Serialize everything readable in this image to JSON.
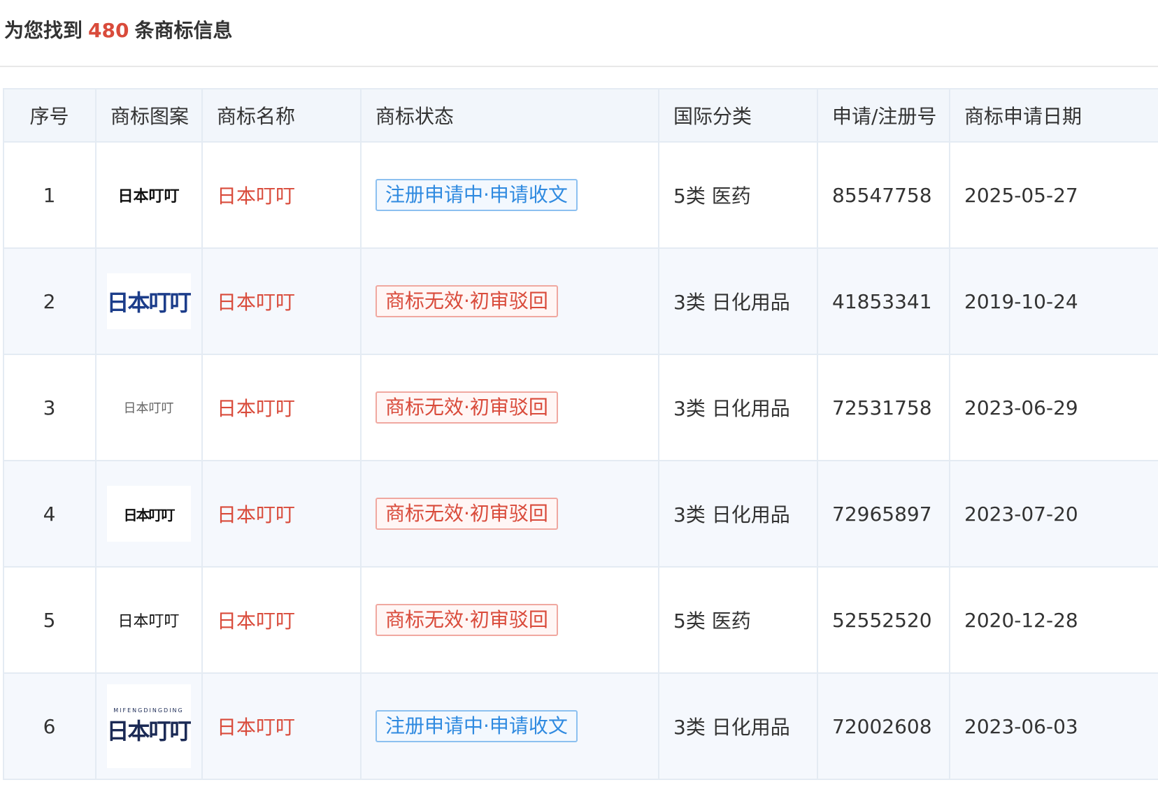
{
  "summary": {
    "prefix": "为您找到",
    "count": "480",
    "suffix": "条商标信息"
  },
  "colors": {
    "accent_red": "#d94b3b",
    "status_blue": "#2f8ae0",
    "header_bg": "#f2f6fb",
    "stripe_bg": "#f5f8fd"
  },
  "table": {
    "headers": {
      "index": "序号",
      "image": "商标图案",
      "name": "商标名称",
      "status": "商标状态",
      "class": "国际分类",
      "reg_no": "申请/注册号",
      "date": "商标申请日期"
    },
    "rows": [
      {
        "index": "1",
        "image_text": "日本叮叮",
        "name": "日本叮叮",
        "status": "注册申请中·申请收文",
        "status_color": "blue",
        "class": "5类 医药",
        "reg_no": "85547758",
        "date": "2025-05-27"
      },
      {
        "index": "2",
        "image_text": "日本叮叮",
        "name": "日本叮叮",
        "status": "商标无效·初审驳回",
        "status_color": "red",
        "class": "3类 日化用品",
        "reg_no": "41853341",
        "date": "2019-10-24"
      },
      {
        "index": "3",
        "image_text": "日本叮叮",
        "name": "日本叮叮",
        "status": "商标无效·初审驳回",
        "status_color": "red",
        "class": "3类 日化用品",
        "reg_no": "72531758",
        "date": "2023-06-29"
      },
      {
        "index": "4",
        "image_text": "日本叮叮",
        "name": "日本叮叮",
        "status": "商标无效·初审驳回",
        "status_color": "red",
        "class": "3类 日化用品",
        "reg_no": "72965897",
        "date": "2023-07-20"
      },
      {
        "index": "5",
        "image_text": "日本叮叮",
        "name": "日本叮叮",
        "status": "商标无效·初审驳回",
        "status_color": "red",
        "class": "5类 医药",
        "reg_no": "52552520",
        "date": "2020-12-28"
      },
      {
        "index": "6",
        "image_subtext": "MIFENGDINGDING",
        "image_text": "日本叮叮",
        "name": "日本叮叮",
        "status": "注册申请中·申请收文",
        "status_color": "blue",
        "class": "3类 日化用品",
        "reg_no": "72002608",
        "date": "2023-06-03"
      }
    ]
  }
}
